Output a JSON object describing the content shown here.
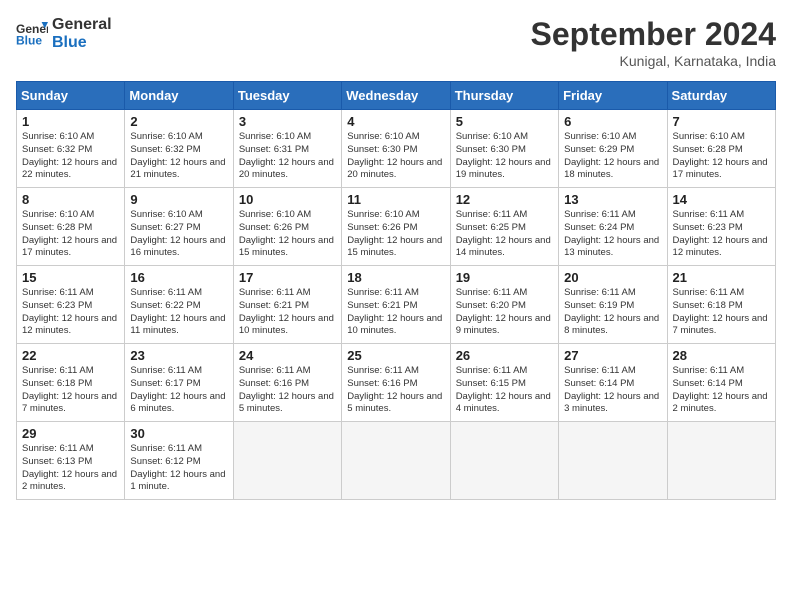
{
  "header": {
    "logo_line1": "General",
    "logo_line2": "Blue",
    "month": "September 2024",
    "location": "Kunigal, Karnataka, India"
  },
  "days_of_week": [
    "Sunday",
    "Monday",
    "Tuesday",
    "Wednesday",
    "Thursday",
    "Friday",
    "Saturday"
  ],
  "weeks": [
    [
      {
        "num": "1",
        "sunrise": "6:10 AM",
        "sunset": "6:32 PM",
        "daylight": "12 hours and 22 minutes."
      },
      {
        "num": "2",
        "sunrise": "6:10 AM",
        "sunset": "6:32 PM",
        "daylight": "12 hours and 21 minutes."
      },
      {
        "num": "3",
        "sunrise": "6:10 AM",
        "sunset": "6:31 PM",
        "daylight": "12 hours and 20 minutes."
      },
      {
        "num": "4",
        "sunrise": "6:10 AM",
        "sunset": "6:30 PM",
        "daylight": "12 hours and 20 minutes."
      },
      {
        "num": "5",
        "sunrise": "6:10 AM",
        "sunset": "6:30 PM",
        "daylight": "12 hours and 19 minutes."
      },
      {
        "num": "6",
        "sunrise": "6:10 AM",
        "sunset": "6:29 PM",
        "daylight": "12 hours and 18 minutes."
      },
      {
        "num": "7",
        "sunrise": "6:10 AM",
        "sunset": "6:28 PM",
        "daylight": "12 hours and 17 minutes."
      }
    ],
    [
      {
        "num": "8",
        "sunrise": "6:10 AM",
        "sunset": "6:28 PM",
        "daylight": "12 hours and 17 minutes."
      },
      {
        "num": "9",
        "sunrise": "6:10 AM",
        "sunset": "6:27 PM",
        "daylight": "12 hours and 16 minutes."
      },
      {
        "num": "10",
        "sunrise": "6:10 AM",
        "sunset": "6:26 PM",
        "daylight": "12 hours and 15 minutes."
      },
      {
        "num": "11",
        "sunrise": "6:10 AM",
        "sunset": "6:26 PM",
        "daylight": "12 hours and 15 minutes."
      },
      {
        "num": "12",
        "sunrise": "6:11 AM",
        "sunset": "6:25 PM",
        "daylight": "12 hours and 14 minutes."
      },
      {
        "num": "13",
        "sunrise": "6:11 AM",
        "sunset": "6:24 PM",
        "daylight": "12 hours and 13 minutes."
      },
      {
        "num": "14",
        "sunrise": "6:11 AM",
        "sunset": "6:23 PM",
        "daylight": "12 hours and 12 minutes."
      }
    ],
    [
      {
        "num": "15",
        "sunrise": "6:11 AM",
        "sunset": "6:23 PM",
        "daylight": "12 hours and 12 minutes."
      },
      {
        "num": "16",
        "sunrise": "6:11 AM",
        "sunset": "6:22 PM",
        "daylight": "12 hours and 11 minutes."
      },
      {
        "num": "17",
        "sunrise": "6:11 AM",
        "sunset": "6:21 PM",
        "daylight": "12 hours and 10 minutes."
      },
      {
        "num": "18",
        "sunrise": "6:11 AM",
        "sunset": "6:21 PM",
        "daylight": "12 hours and 10 minutes."
      },
      {
        "num": "19",
        "sunrise": "6:11 AM",
        "sunset": "6:20 PM",
        "daylight": "12 hours and 9 minutes."
      },
      {
        "num": "20",
        "sunrise": "6:11 AM",
        "sunset": "6:19 PM",
        "daylight": "12 hours and 8 minutes."
      },
      {
        "num": "21",
        "sunrise": "6:11 AM",
        "sunset": "6:18 PM",
        "daylight": "12 hours and 7 minutes."
      }
    ],
    [
      {
        "num": "22",
        "sunrise": "6:11 AM",
        "sunset": "6:18 PM",
        "daylight": "12 hours and 7 minutes."
      },
      {
        "num": "23",
        "sunrise": "6:11 AM",
        "sunset": "6:17 PM",
        "daylight": "12 hours and 6 minutes."
      },
      {
        "num": "24",
        "sunrise": "6:11 AM",
        "sunset": "6:16 PM",
        "daylight": "12 hours and 5 minutes."
      },
      {
        "num": "25",
        "sunrise": "6:11 AM",
        "sunset": "6:16 PM",
        "daylight": "12 hours and 5 minutes."
      },
      {
        "num": "26",
        "sunrise": "6:11 AM",
        "sunset": "6:15 PM",
        "daylight": "12 hours and 4 minutes."
      },
      {
        "num": "27",
        "sunrise": "6:11 AM",
        "sunset": "6:14 PM",
        "daylight": "12 hours and 3 minutes."
      },
      {
        "num": "28",
        "sunrise": "6:11 AM",
        "sunset": "6:14 PM",
        "daylight": "12 hours and 2 minutes."
      }
    ],
    [
      {
        "num": "29",
        "sunrise": "6:11 AM",
        "sunset": "6:13 PM",
        "daylight": "12 hours and 2 minutes."
      },
      {
        "num": "30",
        "sunrise": "6:11 AM",
        "sunset": "6:12 PM",
        "daylight": "12 hours and 1 minute."
      },
      null,
      null,
      null,
      null,
      null
    ]
  ]
}
